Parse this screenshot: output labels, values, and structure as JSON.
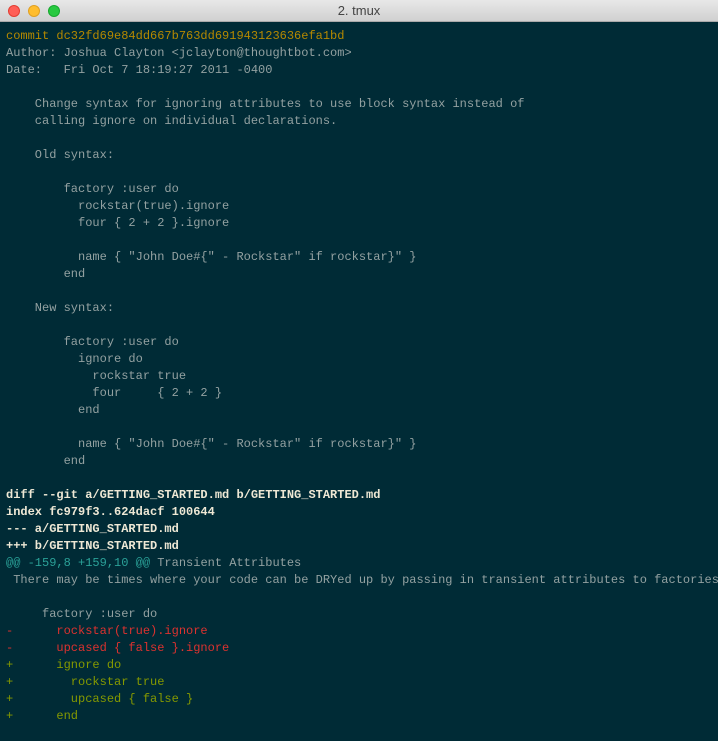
{
  "window": {
    "title": "2. tmux"
  },
  "lines": [
    {
      "segments": [
        {
          "text": "commit dc32fd69e84dd667b763dd691943123636efa1bd",
          "cls": "yellow"
        }
      ]
    },
    {
      "segments": [
        {
          "text": "Author: Joshua Clayton <jclayton@thoughtbot.com>"
        }
      ]
    },
    {
      "segments": [
        {
          "text": "Date:   Fri Oct 7 18:19:27 2011 -0400"
        }
      ]
    },
    {
      "segments": [
        {
          "text": " "
        }
      ]
    },
    {
      "segments": [
        {
          "text": "    Change syntax for ignoring attributes to use block syntax instead of"
        }
      ]
    },
    {
      "segments": [
        {
          "text": "    calling ignore on individual declarations."
        }
      ]
    },
    {
      "segments": [
        {
          "text": " "
        }
      ]
    },
    {
      "segments": [
        {
          "text": "    Old syntax:"
        }
      ]
    },
    {
      "segments": [
        {
          "text": " "
        }
      ]
    },
    {
      "segments": [
        {
          "text": "        factory :user do"
        }
      ]
    },
    {
      "segments": [
        {
          "text": "          rockstar(true).ignore"
        }
      ]
    },
    {
      "segments": [
        {
          "text": "          four { 2 + 2 }.ignore"
        }
      ]
    },
    {
      "segments": [
        {
          "text": " "
        }
      ]
    },
    {
      "segments": [
        {
          "text": "          name { \"John Doe#{\" - Rockstar\" if rockstar}\" }"
        }
      ]
    },
    {
      "segments": [
        {
          "text": "        end"
        }
      ]
    },
    {
      "segments": [
        {
          "text": " "
        }
      ]
    },
    {
      "segments": [
        {
          "text": "    New syntax:"
        }
      ]
    },
    {
      "segments": [
        {
          "text": " "
        }
      ]
    },
    {
      "segments": [
        {
          "text": "        factory :user do"
        }
      ]
    },
    {
      "segments": [
        {
          "text": "          ignore do"
        }
      ]
    },
    {
      "segments": [
        {
          "text": "            rockstar true"
        }
      ]
    },
    {
      "segments": [
        {
          "text": "            four     { 2 + 2 }"
        }
      ]
    },
    {
      "segments": [
        {
          "text": "          end"
        }
      ]
    },
    {
      "segments": [
        {
          "text": " "
        }
      ]
    },
    {
      "segments": [
        {
          "text": "          name { \"John Doe#{\" - Rockstar\" if rockstar}\" }"
        }
      ]
    },
    {
      "segments": [
        {
          "text": "        end"
        }
      ]
    },
    {
      "segments": [
        {
          "text": " "
        }
      ]
    },
    {
      "segments": [
        {
          "text": "diff --git a/GETTING_STARTED.md b/GETTING_STARTED.md",
          "cls": "white bold"
        }
      ]
    },
    {
      "segments": [
        {
          "text": "index fc979f3..624dacf 100644",
          "cls": "white bold"
        }
      ]
    },
    {
      "segments": [
        {
          "text": "--- a/GETTING_STARTED.md",
          "cls": "white bold"
        }
      ]
    },
    {
      "segments": [
        {
          "text": "+++ b/GETTING_STARTED.md",
          "cls": "white bold"
        }
      ]
    },
    {
      "segments": [
        {
          "text": "@@ -159,8 +159,10 @@",
          "cls": "cyan"
        },
        {
          "text": " Transient Attributes"
        }
      ]
    },
    {
      "segments": [
        {
          "text": " There may be times where your code can be DRYed up by passing in transient attributes to factories."
        }
      ]
    },
    {
      "segments": [
        {
          "text": " "
        }
      ]
    },
    {
      "segments": [
        {
          "text": "     factory :user do"
        }
      ]
    },
    {
      "segments": [
        {
          "text": "-      rockstar(true).ignore",
          "cls": "red"
        }
      ]
    },
    {
      "segments": [
        {
          "text": "-      upcased { false }.ignore",
          "cls": "red"
        }
      ]
    },
    {
      "segments": [
        {
          "text": "+      ignore do",
          "cls": "green"
        }
      ]
    },
    {
      "segments": [
        {
          "text": "+        rockstar true",
          "cls": "green"
        }
      ]
    },
    {
      "segments": [
        {
          "text": "+        upcased { false }",
          "cls": "green"
        }
      ]
    },
    {
      "segments": [
        {
          "text": "+      end",
          "cls": "green"
        }
      ]
    },
    {
      "segments": [
        {
          "text": ""
        }
      ]
    }
  ]
}
